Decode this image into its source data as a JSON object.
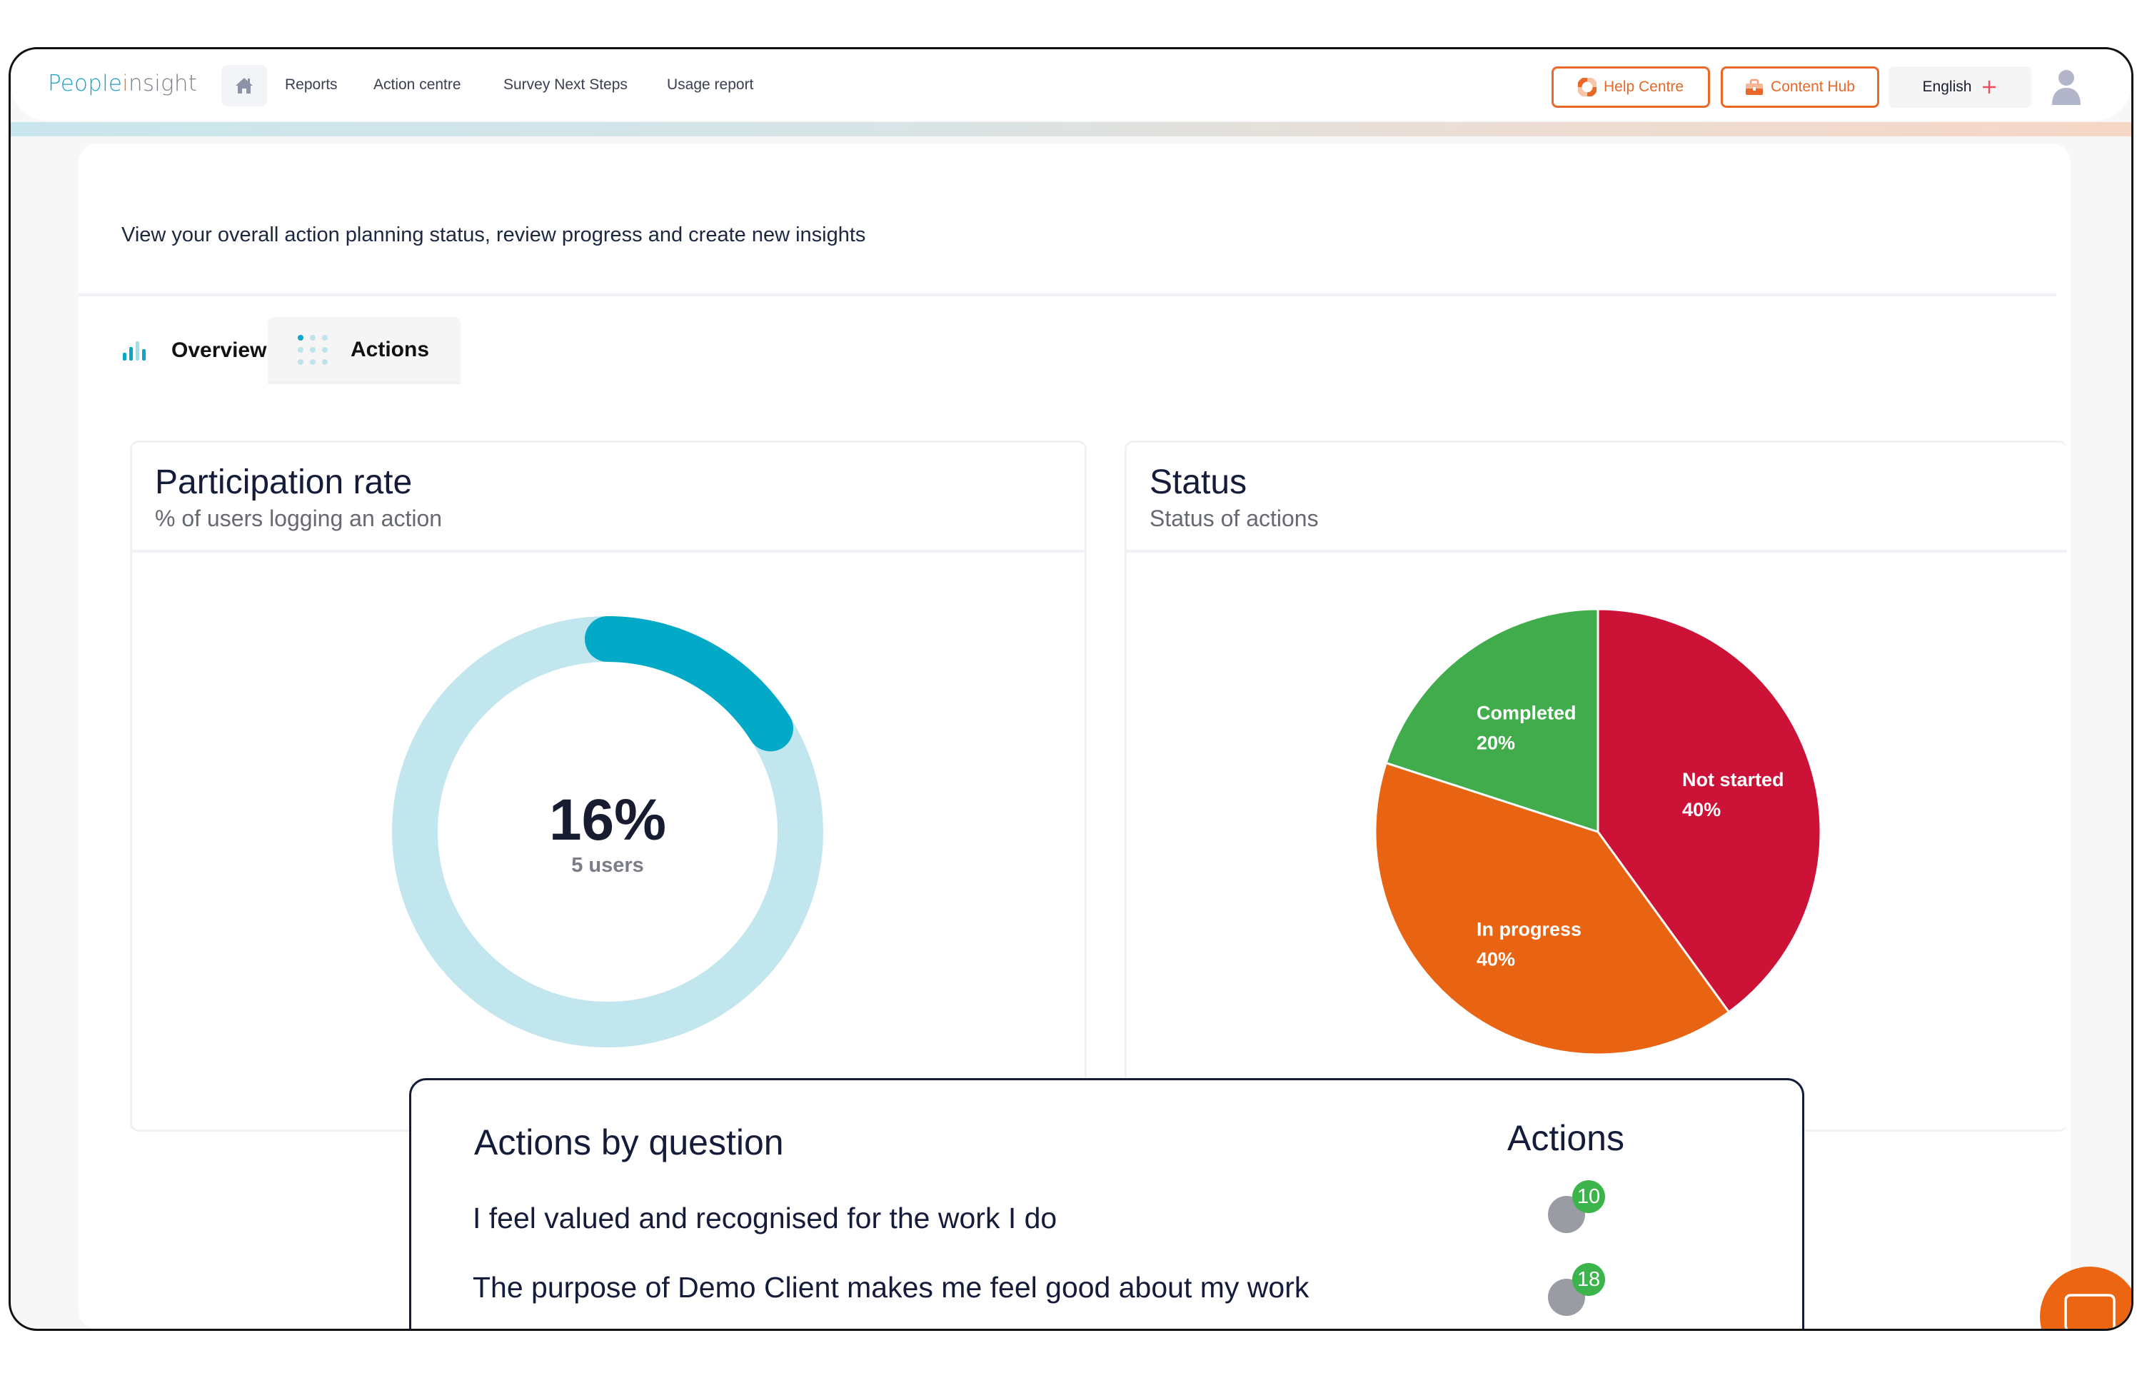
{
  "brand": {
    "logo_part1": "People",
    "logo_part2": "i",
    "logo_part3": "nsight",
    "accent_teal": "#03aac8",
    "accent_orange": "#e8682a"
  },
  "nav": {
    "home_icon": "home-icon",
    "items": [
      {
        "label": "Reports"
      },
      {
        "label": "Action centre"
      },
      {
        "label": "Survey Next Steps"
      },
      {
        "label": "Usage report"
      }
    ],
    "help_centre": {
      "label": "Help Centre",
      "icon": "lifebuoy-icon"
    },
    "content_hub": {
      "label": "Content Hub",
      "icon": "briefcase-icon"
    },
    "language": {
      "label": "English",
      "icon": "plus-icon"
    },
    "avatar_icon": "user-avatar-icon"
  },
  "page": {
    "intro": "View your overall action planning status, review progress and create new insights",
    "tabs": [
      {
        "label": "Overview",
        "icon": "bar-chart-icon",
        "active": false
      },
      {
        "label": "Actions",
        "icon": "dots-grid-icon",
        "active": true
      }
    ]
  },
  "participation": {
    "title": "Participation rate",
    "subtitle": "% of users  logging an action",
    "value_label": "16%",
    "users_label": "5 users"
  },
  "status": {
    "title": "Status",
    "subtitle": "Status of actions"
  },
  "actions_by_question": {
    "title": "Actions by question",
    "column_header": "Actions",
    "rows": [
      {
        "question": "I feel valued and recognised for the work I do",
        "count": "10"
      },
      {
        "question": "The purpose of Demo Client makes me feel good about my work",
        "count": "18"
      }
    ]
  },
  "chat": {
    "icon": "chat-bubble-icon"
  },
  "chart_data": [
    {
      "type": "pie",
      "variant": "donut-progress",
      "title": "Participation rate",
      "subtitle": "% of users  logging an action",
      "value": 16,
      "max": 100,
      "center_label": "16%",
      "center_sublabel": "5 users",
      "colors": {
        "fill": "#03aac8",
        "track": "#c2e6ee"
      }
    },
    {
      "type": "pie",
      "title": "Status",
      "subtitle": "Status of actions",
      "slices": [
        {
          "label": "Not started",
          "value": 40,
          "display": "40%",
          "color": "#cc1237"
        },
        {
          "label": "In progress",
          "value": 40,
          "display": "40%",
          "color": "#e96412"
        },
        {
          "label": "Completed",
          "value": 20,
          "display": "20%",
          "color": "#41ac4b"
        }
      ],
      "start_angle": "12 o'clock",
      "direction": "clockwise"
    }
  ]
}
